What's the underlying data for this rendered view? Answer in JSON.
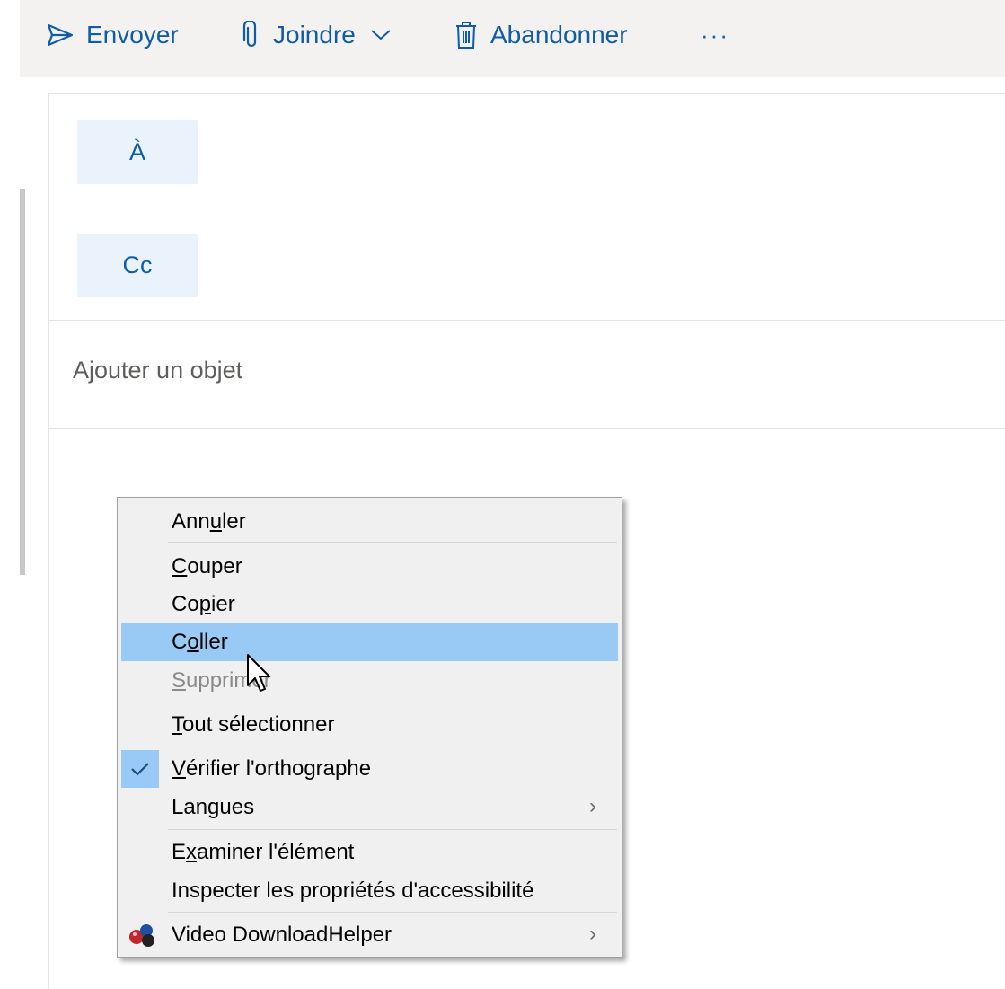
{
  "toolbar": {
    "send_label": "Envoyer",
    "attach_label": "Joindre",
    "discard_label": "Abandonner",
    "more_label": "···"
  },
  "compose": {
    "to_label": "À",
    "cc_label": "Cc",
    "subject_placeholder": "Ajouter un objet"
  },
  "context_menu": {
    "items": [
      {
        "label_pre": "Ann",
        "accel": "u",
        "label_post": "ler",
        "state": "enabled"
      },
      {
        "label_pre": "",
        "accel": "C",
        "label_post": "ouper",
        "state": "enabled"
      },
      {
        "label_pre": "Co",
        "accel": "p",
        "label_post": "ier",
        "state": "enabled"
      },
      {
        "label_pre": "C",
        "accel": "o",
        "label_post": "ller",
        "state": "highlighted"
      },
      {
        "label_pre": "",
        "accel": "S",
        "label_post": "upprimer",
        "state": "disabled"
      },
      {
        "label_pre": "",
        "accel": "T",
        "label_post": "out sélectionner",
        "state": "enabled"
      },
      {
        "label_pre": "",
        "accel": "V",
        "label_post": "érifier l'orthographe",
        "state": "checked"
      },
      {
        "label_pre": "Lan",
        "accel": "g",
        "label_post": "ues",
        "state": "submenu"
      },
      {
        "label_pre": "E",
        "accel": "x",
        "label_post": "aminer l'élément",
        "state": "enabled"
      },
      {
        "label_pre": "Inspecter les propriétés d'accessibilité",
        "accel": "",
        "label_post": "",
        "state": "enabled"
      },
      {
        "label_pre": "Video DownloadHelper",
        "accel": "",
        "label_post": "",
        "state": "submenu"
      }
    ],
    "submenu_arrow": "›"
  },
  "colors": {
    "accent": "#0f5ca8",
    "highlight": "#99c9f5",
    "toolbar_bg": "#f3f2f1",
    "menu_bg": "#f0f0f0"
  }
}
